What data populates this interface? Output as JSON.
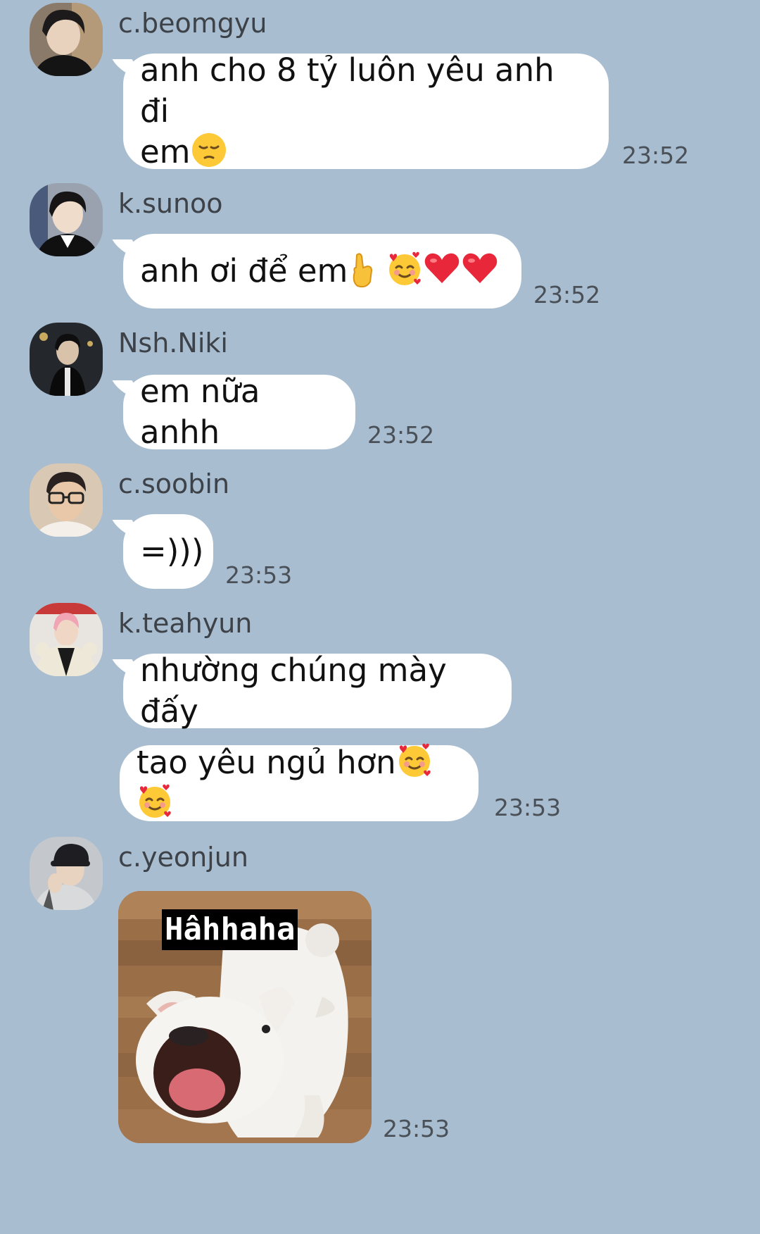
{
  "messages": [
    {
      "sender": "c.beomgyu",
      "avatar": "avatar-dark-hair-icon",
      "bubbles": [
        {
          "line1": "anh cho 8 tỷ luôn yêu anh đi",
          "line2": "em",
          "emoji": [
            "pensive-face-emoji"
          ]
        }
      ],
      "time": "23:52"
    },
    {
      "sender": "k.sunoo",
      "avatar": "avatar-suit-icon",
      "bubbles": [
        {
          "text": "anh ơi để em",
          "emoji": [
            "crossed-fingers-heart-emoji",
            "smiling-face-with-hearts-emoji",
            "red-heart-emoji",
            "red-heart-emoji"
          ]
        }
      ],
      "time": "23:52"
    },
    {
      "sender": "Nsh.Niki",
      "avatar": "avatar-night-icon",
      "bubbles": [
        {
          "text": "em nữa anhh"
        }
      ],
      "time": "23:52"
    },
    {
      "sender": "c.soobin",
      "avatar": "avatar-glasses-icon",
      "bubbles": [
        {
          "text": "=)))"
        }
      ],
      "time": "23:53"
    },
    {
      "sender": "k.teahyun",
      "avatar": "avatar-pink-hair-icon",
      "bubbles": [
        {
          "text": "nhường chúng mày đấy"
        },
        {
          "text": "tao yêu ngủ hơn",
          "emoji": [
            "smiling-face-with-hearts-emoji",
            "smiling-face-with-hearts-emoji"
          ]
        }
      ],
      "time": "23:53"
    },
    {
      "sender": "c.yeonjun",
      "avatar": "avatar-cap-icon",
      "sticker": {
        "caption": "Hâhhaha",
        "subject": "laughing-white-dog-sticker"
      },
      "time": "23:53"
    }
  ],
  "colors": {
    "background": "#a8bdd0",
    "bubble": "#ffffff",
    "sender_text": "#3d4148",
    "time_text": "#4a5058"
  }
}
